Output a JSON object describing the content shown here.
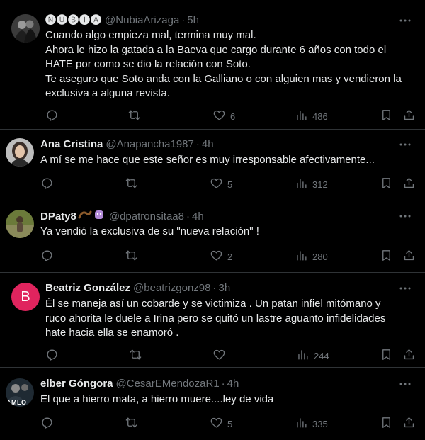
{
  "tweets": [
    {
      "name": "🅝🅤🅑🅘🅐",
      "handle": "@NubiaArizaga",
      "time": "5h",
      "lines": [
        "Cuando algo empieza mal, termina muy mal.",
        "Ahora le hizo la gatada a la Baeva que cargo durante 6 años con todo el",
        "HATE por como se dio la relación con Soto.",
        "Te aseguro que Soto anda con la Galliano o con alguien mas y vendieron la",
        "exclusiva a alguna revista."
      ],
      "replies": "",
      "reposts": "",
      "likes": "6",
      "views": "486"
    },
    {
      "name": "Ana Cristina",
      "handle": "@Anapancha1987",
      "time": "4h",
      "lines": [
        "A mí se me hace que este señor es muy irresponsable afectivamente..."
      ],
      "replies": "",
      "reposts": "",
      "likes": "5",
      "views": "312"
    },
    {
      "name": "DPaty8",
      "handle": "@dpatronsitaa8",
      "time": "4h",
      "lines": [
        "Ya vendió la exclusiva de su \"nueva relación\" !"
      ],
      "replies": "",
      "reposts": "",
      "likes": "2",
      "views": "280"
    },
    {
      "name": "Beatriz González",
      "handle": "@beatrizgonz98",
      "time": "3h",
      "avatar_letter": "B",
      "lines": [
        "Él se maneja así un cobarde y se victimiza .   Un patan infiel mitómano y",
        "ruco ahorita le duele a Irina pero se quitó un lastre aguanto infidelidades",
        "hate hacia ella se enamoró ."
      ],
      "replies": "",
      "reposts": "",
      "likes": "",
      "views": "244"
    },
    {
      "name": "elber Góngora",
      "handle": "@CesarEMendozaR1",
      "time": "4h",
      "avatar_text": "AMLO",
      "lines": [
        "El que a hierro mata, a hierro muere....ley de vida"
      ],
      "replies": "",
      "reposts": "",
      "likes": "5",
      "views": "335"
    }
  ],
  "icons": {
    "reply": "reply-icon",
    "repost": "repost-icon",
    "like": "heart-icon",
    "views": "views-icon",
    "bookmark": "bookmark-icon",
    "share": "share-icon",
    "more": "more-icon"
  },
  "colors": {
    "background": "#000000",
    "text": "#e7e9ea",
    "muted": "#71767b",
    "divider": "#2f3336",
    "beatriz_avatar": "#e0245e"
  }
}
